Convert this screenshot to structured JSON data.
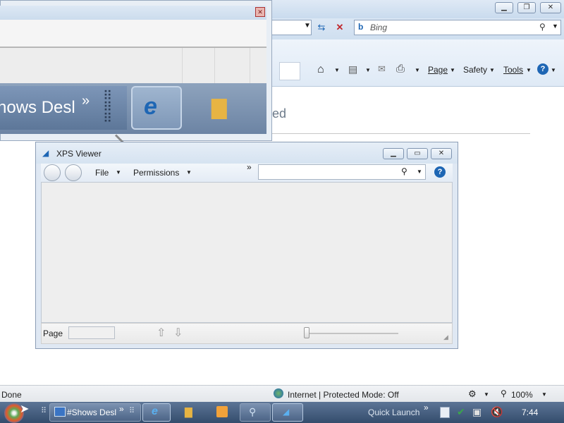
{
  "ie": {
    "search_placeholder": "Bing",
    "commands": {
      "page": "Page",
      "safety": "Safety",
      "tools": "Tools"
    },
    "content_fragment": "ed",
    "status": {
      "left": "Done",
      "zone": "Internet | Protected Mode: Off",
      "zoom": "100%"
    },
    "caption": {
      "min": "▁",
      "restore": "❐",
      "close": "✕"
    }
  },
  "magnifier": {
    "taskitem_label": "hows Desl",
    "chevron": "»"
  },
  "xps": {
    "title": "XPS Viewer",
    "menu": {
      "file": "File",
      "permissions": "Permissions"
    },
    "chevron": "»",
    "status": {
      "page_label": "Page"
    }
  },
  "taskbar": {
    "task_label": "#Shows Desl",
    "chevron": "»",
    "quick_launch": "Quick Launch",
    "clock": "7:44"
  },
  "colors": {
    "accent": "#1e66b4",
    "taskbar": "#3c5576"
  }
}
